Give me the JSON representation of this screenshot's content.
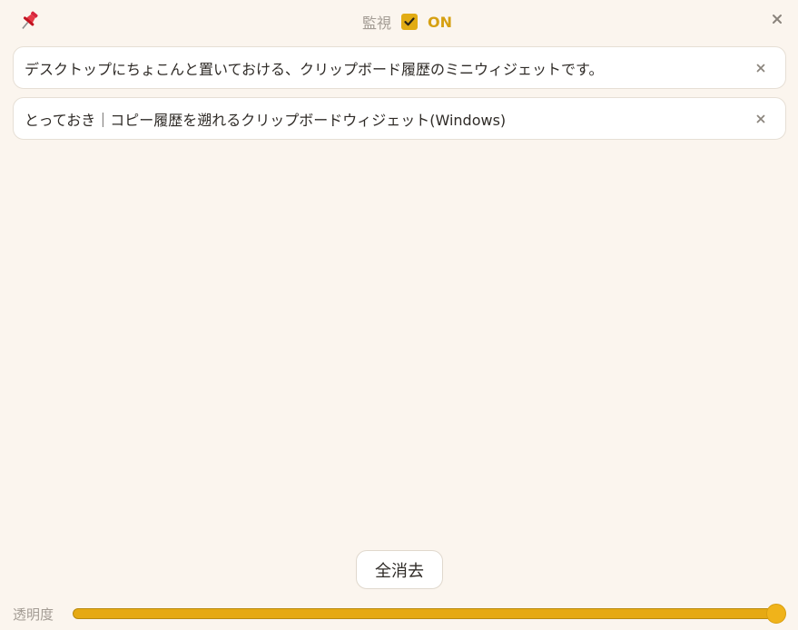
{
  "header": {
    "pin_icon": "pushpin-icon",
    "monitor_label": "監視",
    "monitor_checked": true,
    "on_label": "ON",
    "close_icon": "close-icon"
  },
  "items": [
    {
      "text": "デスクトップにちょこんと置いておける、クリップボード履歴のミニウィジェットです。"
    },
    {
      "text": "とっておき｜コピー履歴を遡れるクリップボードウィジェット(Windows)"
    }
  ],
  "footer": {
    "clear_all_label": "全消去",
    "opacity_label": "透明度",
    "opacity_value": 1.0
  },
  "colors": {
    "accent": "#e6a912",
    "background": "#fbf5ee",
    "muted_text": "#a39c94"
  }
}
